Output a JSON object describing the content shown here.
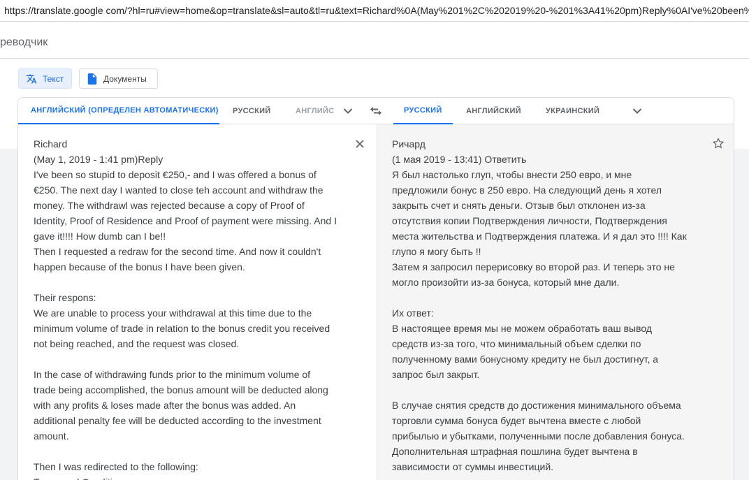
{
  "browser": {
    "url": "https://translate.google com/?hl=ru#view=home&op=translate&sl=auto&tl=ru&text=Richard%0A(May%201%2C%202019%20-%201%3A41%20pm)Reply%0AI've%20been%20so"
  },
  "app": {
    "title": "реводчик"
  },
  "modes": {
    "text_label": "Текст",
    "docs_label": "Документы"
  },
  "source_langs": {
    "detected": "АНГЛИЙСКИЙ (ОПРЕДЕЛЕН АВТОМАТИЧЕСКИ)",
    "russian": "РУССКИЙ",
    "english_cut": "АНГЛИЙС"
  },
  "target_langs": {
    "russian": "РУССКИЙ",
    "english": "АНГЛИЙСКИЙ",
    "ukrainian": "УКРАИНСКИЙ"
  },
  "icons": {
    "text_mode": "translate-icon",
    "docs_mode": "document-icon",
    "swap": "swap-arrows-icon",
    "more_source": "chevron-down-icon",
    "more_target": "chevron-down-icon",
    "clear": "close-icon",
    "save": "star-icon"
  },
  "colors": {
    "accent": "#1a73e8",
    "active_bg": "#e8f0fe",
    "border": "#dadce0"
  },
  "source_text": "Richard\n(May 1, 2019 - 1:41 pm)Reply\nI've been so stupid to deposit €250,- and I was offered a bonus of\n€250. The next day I wanted to close teh account and withdraw the\nmoney. The withdrawl was rejected because a copy of Proof of\nIdentity, Proof of Residence and Proof of payment were missing. And I\ngave it!!!! How dumb can I be!!\nThen I requested a redraw for the second time. And now it couldn't\nhappen because of the bonus I have been given.\n\nTheir respons:\nWe are unable to process your withdrawal at this time due to the\nminimum volume of trade in relation to the bonus credit you received\nnot being reached, and the request was closed.\n\nIn the case of withdrawing funds prior to the minimum volume of\ntrade being accomplished, the bonus amount will be deducted along\nwith any profits & loses made after the bonus was added. An\nadditional penalty fee will be deducted according to the investment\namount.\n\nThen I was redirected to the following:\nTerms and Conditions",
  "translated_text": "Ричард\n(1 мая 2019 - 13:41) Ответить\nЯ был настолько глуп, чтобы внести 250 евро, и мне\nпредложили бонус в 250 евро. На следующий день я хотел\nзакрыть счет и снять деньги. Отзыв был отклонен из-за\nотсутствия копии Подтверждения личности, Подтверждения\nместа жительства и Подтверждения платежа. И я дал это !!!! Как\nглупо я могу быть !!\nЗатем я запросил перерисовку во второй раз. И теперь это не\nмогло произойти из-за бонуса, который мне дали.\n\nИх ответ:\nВ настоящее время мы не можем обработать ваш вывод\nсредств из-за того, что минимальный объем сделки по\nполученному вами бонусному кредиту не был достигнут, а\nзапрос был закрыт.\n\nВ случае снятия средств до достижения минимального объема\nторговли сумма бонуса будет вычтена вместе с любой\nприбылью и убытками, полученными после добавления бонуса.\nДополнительная штрафная пошлина будет вычтена в\nзависимости от суммы инвестиций."
}
